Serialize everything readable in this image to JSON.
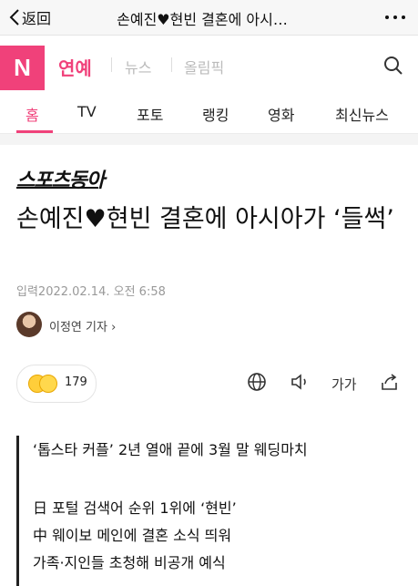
{
  "topbar": {
    "back_label": "返回",
    "title": "손예진♥현빈 결혼에 아시…"
  },
  "nav": {
    "logo": "N",
    "section": "연예",
    "links": [
      "뉴스",
      "올림픽"
    ]
  },
  "tabs": [
    "홈",
    "TV",
    "포토",
    "랭킹",
    "영화",
    "최신뉴스"
  ],
  "article": {
    "publisher": "스포츠동아",
    "headline": "손예진♥현빈 결혼에 아시아가 ‘들썩’",
    "dateline": "입력2022.02.14. 오전 6:58",
    "reporter": "이정연 기자 ›",
    "reaction_count": "179",
    "fontsize_label": "가가",
    "summary": [
      "‘톱스타 커플’ 2년 열애 끝에 3월 말 웨딩마치",
      "日 포털 검색어 순위 1위에 ‘현빈’",
      "中 웨이보 메인에 결혼 소식 띄워",
      "가족·지인들 초청해 비공개 예식"
    ]
  },
  "colors": {
    "brand": "#f0417a"
  }
}
